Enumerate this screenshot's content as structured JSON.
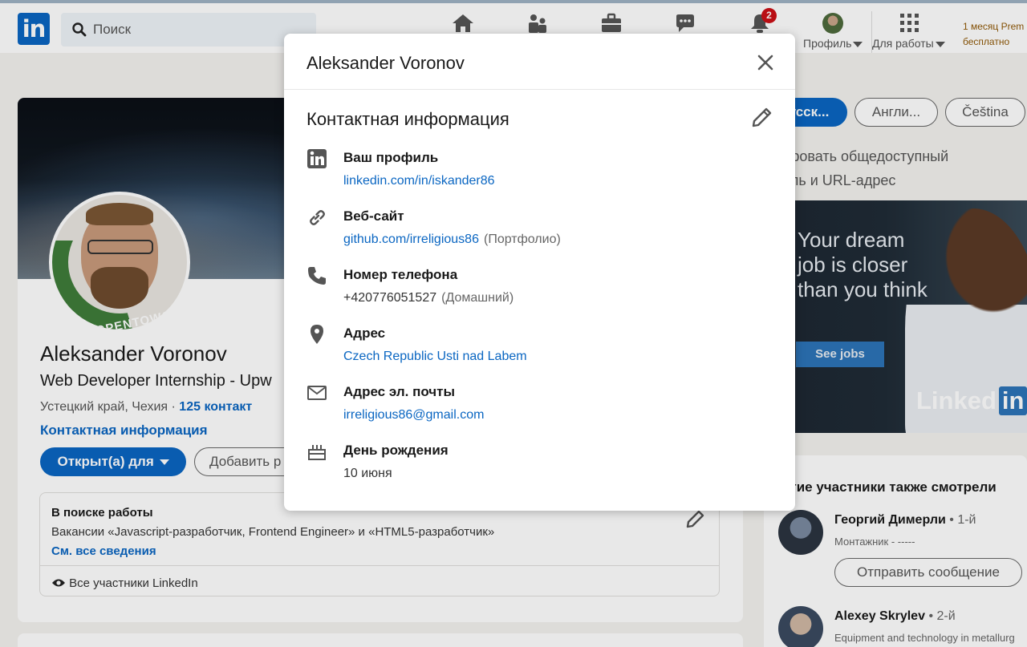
{
  "nav": {
    "logo": "in",
    "search_placeholder": "Поиск",
    "notifications_badge": "2",
    "profile_label": "Профиль",
    "work_label": "Для работы",
    "premium_line1": "1 месяц Prem",
    "premium_line2": "бесплатно"
  },
  "profile": {
    "name": "Aleksander Voronov",
    "headline": "Web Developer Internship - Upw",
    "location": "Устецкий край, Чехия",
    "connections": "125 контакт",
    "contact_link": "Контактная информация",
    "open_button": "Открыт(а) для",
    "add_button": "Добавить р",
    "ring_text": "#OPENTOWORK",
    "job": {
      "title": "В поиске работы",
      "description": "Вакансии «Javascript-разработчик, Frontend Engineer» и «HTML5-разработчик»",
      "more": "См. все сведения",
      "visibility": "Все участники LinkedIn"
    }
  },
  "right": {
    "languages": [
      "усск...",
      "Англи...",
      "Čeština"
    ],
    "edit_url": "ктировать общедоступный\nфиль и URL-адрес",
    "ad": {
      "text": "Your dream job is closer than you think",
      "button": "See jobs",
      "logo_text": "Linked",
      "logo_box": "in"
    },
    "others_title": "ругие участники также смотрели",
    "people": [
      {
        "name": "Георгий Димерли",
        "degree": "• 1-й",
        "occupation": "Монтажник - -----"
      },
      {
        "name": "Alexey Skrylev",
        "degree": "• 2-й",
        "occupation": "Equipment and technology in metallurg"
      }
    ],
    "message_button": "Отправить сообщение"
  },
  "modal": {
    "title": "Aleksander Voronov",
    "section_title": "Контактная информация",
    "items": [
      {
        "label": "Ваш профиль",
        "value": "linkedin.com/in/iskander86",
        "note": ""
      },
      {
        "label": "Веб-сайт",
        "value": "github.com/irreligious86",
        "note": "(Портфолио)"
      },
      {
        "label": "Номер телефона",
        "value": "+420776051527",
        "note": "(Домашний)"
      },
      {
        "label": "Адрес",
        "value": "Czech Republic Usti nad Labem",
        "note": ""
      },
      {
        "label": "Адрес эл. почты",
        "value": "irreligious86@gmail.com",
        "note": ""
      },
      {
        "label": "День рождения",
        "value": "10 июня",
        "note": ""
      }
    ]
  },
  "colors": {
    "brand": "#0a66c2",
    "badge": "#cc1016",
    "opentowork": "#3f7d3a"
  }
}
